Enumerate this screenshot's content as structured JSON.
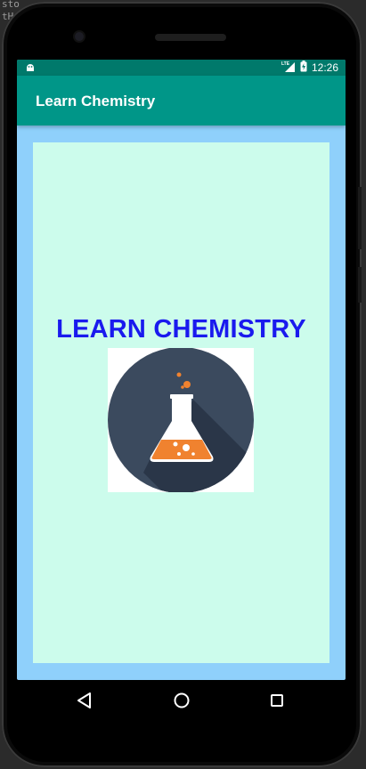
{
  "background_editor": {
    "line1": "sto",
    "line2": "tH"
  },
  "status_bar": {
    "time": "12:26",
    "network": "LTE",
    "icons": [
      "android-debug-icon",
      "lte-signal-icon",
      "battery-charging-icon"
    ]
  },
  "app_bar": {
    "title": "Learn Chemistry"
  },
  "content": {
    "headline": "LEARN CHEMISTRY",
    "image": "chemistry-flask-icon"
  },
  "nav_bar": {
    "buttons": [
      "back-icon",
      "home-icon",
      "recents-icon"
    ]
  },
  "colors": {
    "status_bar": "#00796b",
    "app_bar": "#009688",
    "screen_bg": "#8fd0fb",
    "content_bg": "#ccfcec",
    "headline": "#1a1aee",
    "flask_circle": "#3b4a5e",
    "flask_liquid": "#f0822f"
  }
}
